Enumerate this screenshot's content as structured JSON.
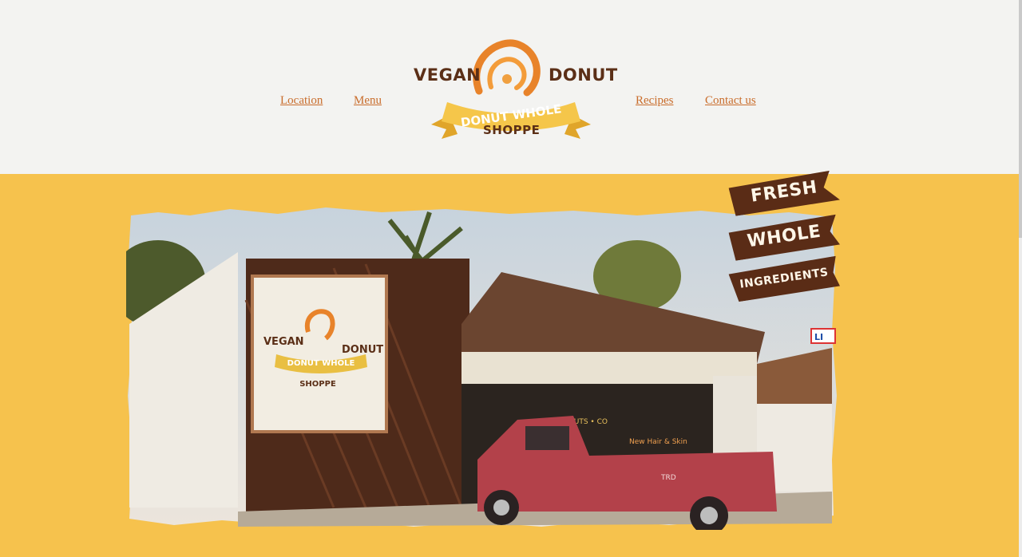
{
  "nav": {
    "left": [
      "Location",
      "Menu"
    ],
    "right": [
      "Recipes",
      "Contact us"
    ]
  },
  "logo": {
    "word_left": "VEGAN",
    "word_right": "DONUT",
    "ribbon": "DONUT WHOLE",
    "bottom": "SHOPPE"
  },
  "hero": {
    "banners": [
      "FRESH",
      "WHOLE",
      "INGREDIENTS"
    ],
    "sign": {
      "word_left": "VEGAN",
      "word_right": "DONUT",
      "ribbon": "DONUT WHOLE",
      "bottom": "SHOPPE"
    },
    "window_text": "DONUTS • CO",
    "neon_text": "New Hair & Skin",
    "truck_badge": "TRD",
    "side_sign": "LI"
  },
  "colors": {
    "accent": "#f6c24d",
    "brand_brown": "#5b2f17",
    "link": "#c96d2c",
    "header_bg": "#f3f3f1"
  }
}
